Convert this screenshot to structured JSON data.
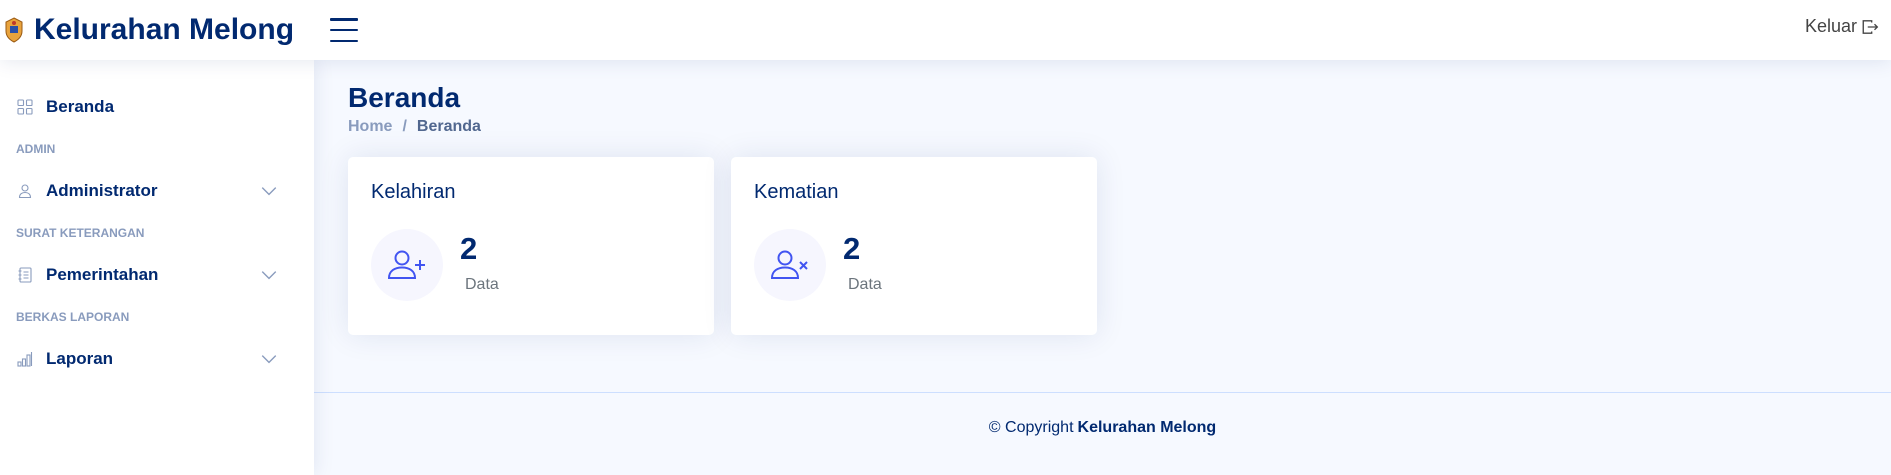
{
  "header": {
    "title": "Kelurahan Melong",
    "logout_label": "Keluar"
  },
  "sidebar": {
    "items": [
      {
        "type": "item",
        "label": "Beranda",
        "icon": "grid-icon"
      },
      {
        "type": "heading",
        "label": "ADMIN"
      },
      {
        "type": "item",
        "label": "Administrator",
        "icon": "person-icon",
        "expandable": true
      },
      {
        "type": "heading",
        "label": "SURAT KETERANGAN"
      },
      {
        "type": "item",
        "label": "Pemerintahan",
        "icon": "journal-icon",
        "expandable": true
      },
      {
        "type": "heading",
        "label": "BERKAS LAPORAN"
      },
      {
        "type": "item",
        "label": "Laporan",
        "icon": "bar-chart-icon",
        "expandable": true
      }
    ]
  },
  "main": {
    "title": "Beranda",
    "breadcrumb": {
      "home": "Home",
      "separator": "/",
      "current": "Beranda"
    },
    "cards": [
      {
        "title": "Kelahiran",
        "value": "2",
        "unit": "Data",
        "icon": "person-plus-icon"
      },
      {
        "title": "Kematian",
        "value": "2",
        "unit": "Data",
        "icon": "person-x-icon"
      }
    ]
  },
  "footer": {
    "prefix": "© Copyright",
    "name": "Kelurahan Melong"
  },
  "colors": {
    "primary": "#012970",
    "accent": "#4154f1",
    "muted": "#899bbd",
    "background": "#f6f9ff"
  }
}
